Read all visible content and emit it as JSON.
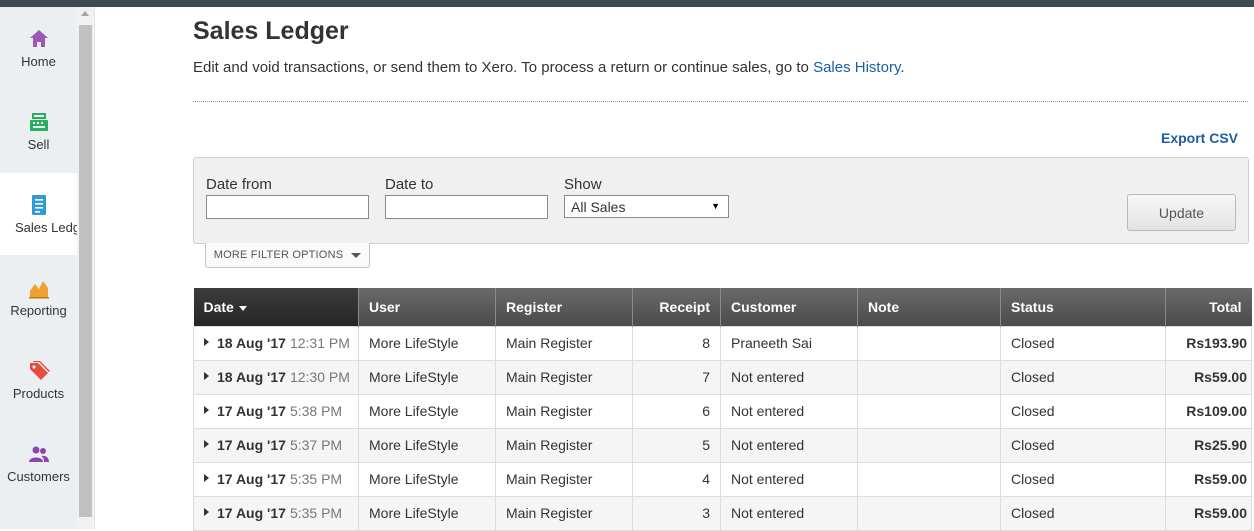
{
  "nav": {
    "items": [
      {
        "label": "Home",
        "icon": "home-icon",
        "color": "#9b59b6",
        "active": false
      },
      {
        "label": "Sell",
        "icon": "register-icon",
        "color": "#27ae60",
        "active": false
      },
      {
        "label": "Sales Ledger",
        "icon": "ledger-icon",
        "color": "#2e9bd6",
        "active": true
      },
      {
        "label": "Reporting",
        "icon": "chart-icon",
        "color": "#f0a030",
        "active": false
      },
      {
        "label": "Products",
        "icon": "tag-icon",
        "color": "#e74c3c",
        "active": false
      },
      {
        "label": "Customers",
        "icon": "users-icon",
        "color": "#8e44ad",
        "active": false
      }
    ]
  },
  "header": {
    "title": "Sales Ledger",
    "subtitle": "Edit and void transactions, or send them to Xero. To process a return or continue sales, go to ",
    "subtitle_link": "Sales History",
    "subtitle_end": "."
  },
  "export_label": "Export CSV",
  "filter": {
    "date_from_label": "Date from",
    "date_from_value": "",
    "date_to_label": "Date to",
    "date_to_value": "",
    "show_label": "Show",
    "show_value": "All Sales",
    "update_label": "Update",
    "more_label": "MORE FILTER OPTIONS"
  },
  "table": {
    "columns": [
      "Date",
      "User",
      "Register",
      "Receipt",
      "Customer",
      "Note",
      "Status",
      "Total"
    ],
    "rows": [
      {
        "date": "18 Aug '17",
        "time": "12:31 PM",
        "user": "More LifeStyle",
        "register": "Main Register",
        "receipt": "8",
        "customer": "Praneeth Sai",
        "customer_link": true,
        "note": "",
        "status": "Closed",
        "total": "Rs193.90"
      },
      {
        "date": "18 Aug '17",
        "time": "12:30 PM",
        "user": "More LifeStyle",
        "register": "Main Register",
        "receipt": "7",
        "customer": "Not entered",
        "customer_link": false,
        "note": "",
        "status": "Closed",
        "total": "Rs59.00"
      },
      {
        "date": "17 Aug '17",
        "time": "5:38 PM",
        "user": "More LifeStyle",
        "register": "Main Register",
        "receipt": "6",
        "customer": "Not entered",
        "customer_link": false,
        "note": "",
        "status": "Closed",
        "total": "Rs109.00"
      },
      {
        "date": "17 Aug '17",
        "time": "5:37 PM",
        "user": "More LifeStyle",
        "register": "Main Register",
        "receipt": "5",
        "customer": "Not entered",
        "customer_link": false,
        "note": "",
        "status": "Closed",
        "total": "Rs25.90"
      },
      {
        "date": "17 Aug '17",
        "time": "5:35 PM",
        "user": "More LifeStyle",
        "register": "Main Register",
        "receipt": "4",
        "customer": "Not entered",
        "customer_link": false,
        "note": "",
        "status": "Closed",
        "total": "Rs59.00"
      },
      {
        "date": "17 Aug '17",
        "time": "5:35 PM",
        "user": "More LifeStyle",
        "register": "Main Register",
        "receipt": "3",
        "customer": "Not entered",
        "customer_link": false,
        "note": "",
        "status": "Closed",
        "total": "Rs59.00"
      }
    ]
  }
}
